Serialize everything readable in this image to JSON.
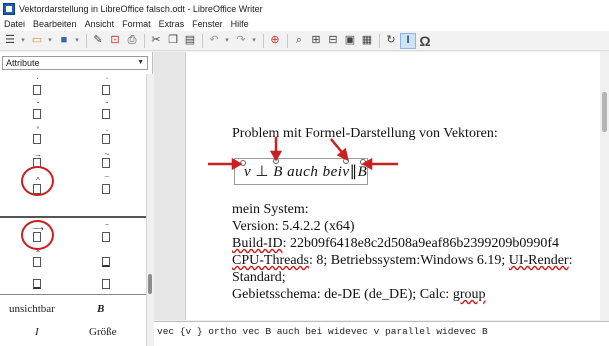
{
  "window": {
    "title": "Vektordarstellung in LibreOffice falsch.odt - LibreOffice Writer"
  },
  "menu": {
    "items": [
      "Datei",
      "Bearbeiten",
      "Ansicht",
      "Format",
      "Extras",
      "Fenster",
      "Hilfe"
    ]
  },
  "toolbar": {
    "icons": [
      "format-mode-icon",
      "open-icon",
      "save-icon",
      "undo-icon",
      "export-pdf-icon",
      "print-icon",
      "cut-icon",
      "copy-icon",
      "paste-icon",
      "undo-arrow-icon",
      "redo-arrow-icon",
      "help-icon",
      "refresh-icon",
      "cursor-icon",
      "omega-icon"
    ],
    "omega": "Ω",
    "cursor": "I"
  },
  "sidebar": {
    "dropdown_value": "Attribute",
    "labels": {
      "invisible": "unsichtbar",
      "bold": "B",
      "italic": "I",
      "size": "Größe"
    }
  },
  "document": {
    "heading": "Problem mit Formel-Darstellung von Vektoren:",
    "formula": {
      "v": "v",
      "ortho": "⊥",
      "B1": "B",
      "auchbei": "auch bei",
      "v2": "v",
      "parallel": "∥",
      "B2": "B"
    },
    "system": {
      "title": "mein System:",
      "version": "Version: 5.4.2.2 (x64)",
      "build_label": "Build-ID",
      "build_rest": ": 22b09f6418e8c2d508a9eaf86b2399209b0990f4",
      "cpu_label": "CPU-Threads",
      "cpu_rest": ": 8; Betriebssystem:Windows 6.19; ",
      "ui_label": "UI-Render",
      "ui_rest": ":",
      "standard": "Standard;",
      "locale_prefix": "Gebietsschema: de-DE (de_DE); Calc: ",
      "locale_group": "group"
    }
  },
  "command_line": {
    "text": "vec {v } ortho vec B auch bei widevec v parallel widevec B"
  },
  "colors": {
    "annotation_red": "#cc1f1f",
    "accent": "#1a5fb4"
  }
}
